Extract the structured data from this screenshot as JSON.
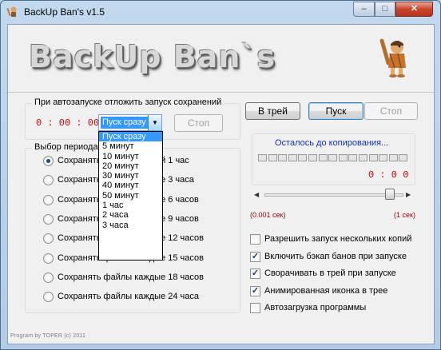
{
  "window": {
    "title": "BackUp Ban's v1.5",
    "minimize_glyph": "–",
    "maximize_glyph": "□",
    "close_glyph": "✕",
    "icon": "caveman-icon"
  },
  "banner": {
    "logo_text": "BackUp Ban`s",
    "mascot_icon": "caveman-icon"
  },
  "delay_group": {
    "title": "При автозапуске отложить запуск сохранений",
    "timer": "0 : 00 : 00",
    "select_value": "Пуск сразу",
    "stop_label": "Стоп",
    "options": [
      "Пуск сразу",
      "5 минут",
      "10 минут",
      "20 минут",
      "30 минут",
      "40 минут",
      "50 минут",
      "1 час",
      "2 часа",
      "3 часа"
    ],
    "selected_index": 0
  },
  "period_group": {
    "title": "Выбор периода",
    "items": [
      {
        "label": "Сохранять файлы каждый 1 час",
        "checked": true
      },
      {
        "label": "Сохранять файлы каждые 3 часа",
        "checked": false
      },
      {
        "label": "Сохранять файлы каждые 6 часов",
        "checked": false
      },
      {
        "label": "Сохранять файлы каждые 9 часов",
        "checked": false
      },
      {
        "label": "Сохранять файлы каждые 12 часов",
        "checked": false
      },
      {
        "label": "Сохранять файлы каждые 15 часов",
        "checked": false
      },
      {
        "label": "Сохранять файлы каждые 18 часов",
        "checked": false
      },
      {
        "label": "Сохранять файлы каждые 24 часа",
        "checked": false
      }
    ]
  },
  "top_buttons": {
    "tray": "В трей",
    "start": "Пуск",
    "stop": "Стоп"
  },
  "progress_group": {
    "label": "Осталось до копирования...",
    "timer": "0 : 0  0",
    "segments": 15,
    "slider_min_label": "(0.001 сек)",
    "slider_max_label": "(1 сек)",
    "slider_level": 0.93
  },
  "options": [
    {
      "label": "Разрешить запуск нескольких копий",
      "checked": false
    },
    {
      "label": "Включить бэкап банов при запуске",
      "checked": true
    },
    {
      "label": "Сворачивать в трей при запуске",
      "checked": true
    },
    {
      "label": "Анимированная иконка в трее",
      "checked": true
    },
    {
      "label": "Автозагрузка программы",
      "checked": false
    }
  ],
  "footer": "Program by TOPER (c) 2011",
  "colors": {
    "timer_red": "#cc0000",
    "progress_label_blue": "#1033b4",
    "selection_blue": "#3399ff"
  }
}
